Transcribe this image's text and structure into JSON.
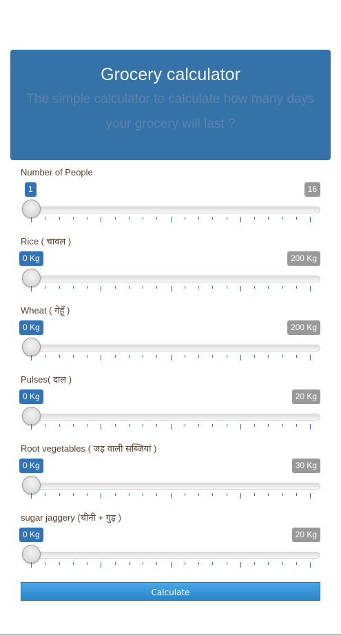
{
  "header": {
    "title": "Grocery calculator",
    "subtitle": "The simple calculator to calculate how many days your grocery will last ?"
  },
  "sliders": [
    {
      "label": "Number of People",
      "min_label": "1",
      "max_label": "16",
      "value_fraction": 0
    },
    {
      "label": "Rice ( चावल )",
      "min_label": "0 Kg",
      "max_label": "200 Kg",
      "value_fraction": 0
    },
    {
      "label": "Wheat ( गेहूँ )",
      "min_label": "0 Kg",
      "max_label": "200 Kg",
      "value_fraction": 0
    },
    {
      "label": "Pulses( दाल )",
      "min_label": "0 Kg",
      "max_label": "20 Kg",
      "value_fraction": 0
    },
    {
      "label": "Root vegetables ( जड़ वाली सब्जियां )",
      "min_label": "0 Kg",
      "max_label": "30 Kg",
      "value_fraction": 0
    },
    {
      "label": "sugar jaggery (चीनी + गुड़ )",
      "min_label": "0 Kg",
      "max_label": "20 Kg",
      "value_fraction": 0
    }
  ],
  "calculate_button": {
    "label": "Calculate"
  },
  "colors": {
    "header_bg": "#3472a8",
    "badge_active": "#3173b4",
    "badge_inactive": "#999999",
    "button": "#2a85c9"
  }
}
